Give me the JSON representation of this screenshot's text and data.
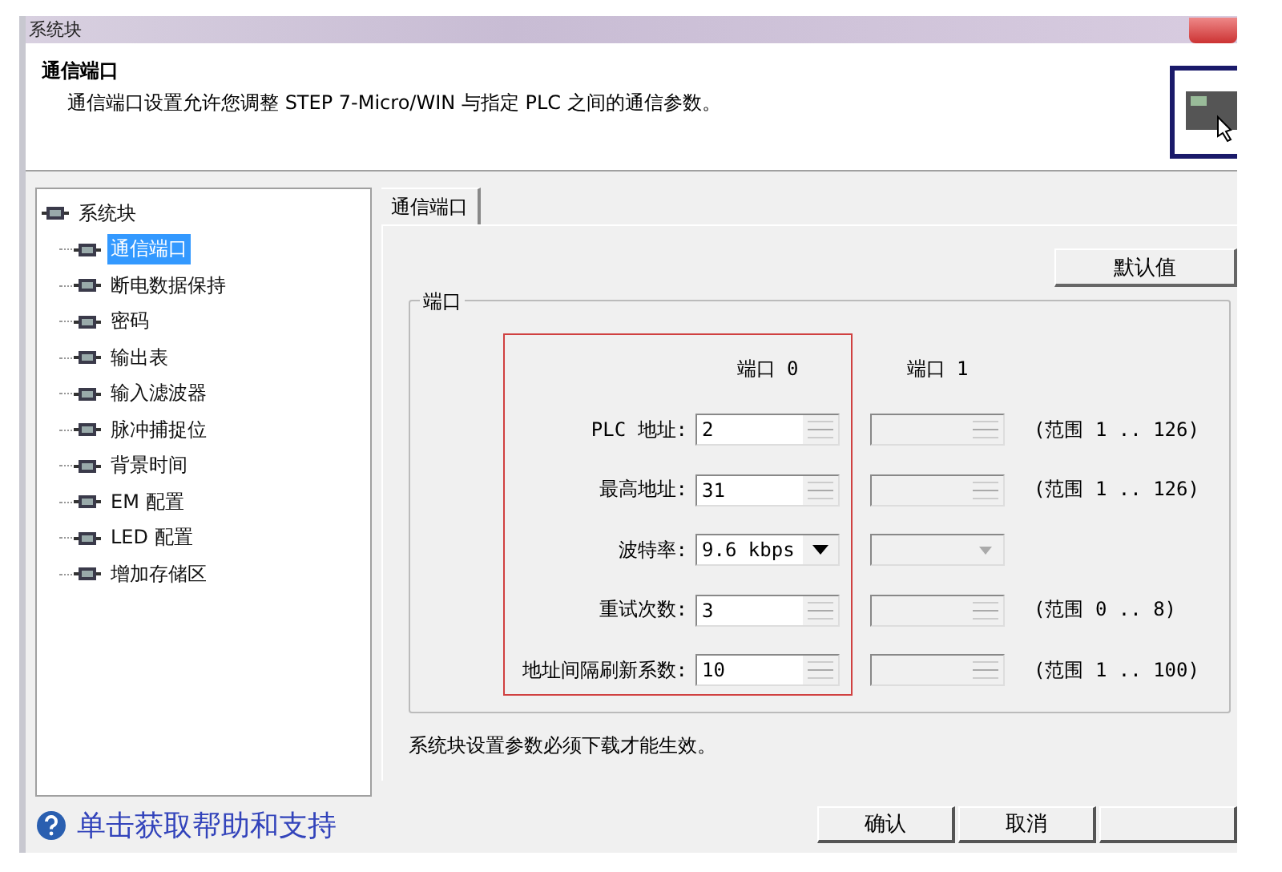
{
  "window": {
    "title": "系统块"
  },
  "header": {
    "title": "通信端口",
    "description": "通信端口设置允许您调整 STEP 7-Micro/WIN 与指定 PLC 之间的通信参数。"
  },
  "tree": {
    "label": "系统块",
    "children": [
      {
        "label": "通信端口",
        "selected": true
      },
      {
        "label": "断电数据保持",
        "selected": false
      },
      {
        "label": "密码",
        "selected": false
      },
      {
        "label": "输出表",
        "selected": false
      },
      {
        "label": "输入滤波器",
        "selected": false
      },
      {
        "label": "脉冲捕捉位",
        "selected": false
      },
      {
        "label": "背景时间",
        "selected": false
      },
      {
        "label": "EM 配置",
        "selected": false
      },
      {
        "label": "LED 配置",
        "selected": false
      },
      {
        "label": "增加存储区",
        "selected": false
      }
    ]
  },
  "tabs": [
    {
      "label": "通信端口",
      "selected": true
    }
  ],
  "default_button": "默认值",
  "group": {
    "title": "端口",
    "columns": [
      "端口 0",
      "端口 1"
    ],
    "highlighted": true,
    "rows": [
      {
        "label": "PLC 地址:",
        "kind": "spin",
        "port0": "2",
        "range": "(范围 1 .. 126)"
      },
      {
        "label": "最高地址:",
        "kind": "spin",
        "port0": "31",
        "range": "(范围 1 .. 126)"
      },
      {
        "label": "波特率:",
        "kind": "select",
        "port0": "9.6 kbps"
      },
      {
        "label": "重试次数:",
        "kind": "spin",
        "port0": "3",
        "range": "(范围 0 .. 8)"
      },
      {
        "label": "地址间隔刷新系数:",
        "kind": "spin",
        "port0": "10",
        "range": "(范围 1 .. 100)"
      }
    ]
  },
  "note": "系统块设置参数必须下载才能生效。",
  "help_link": "单击获取帮助和支持",
  "buttons": [
    "确认",
    "取消"
  ]
}
